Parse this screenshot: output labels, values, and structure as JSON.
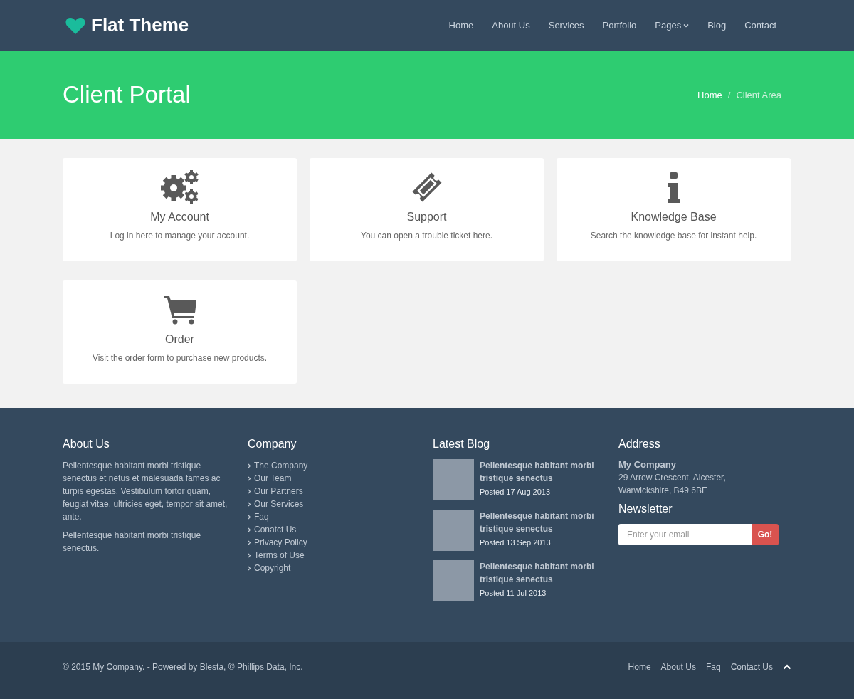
{
  "header": {
    "logo": "Flat Theme",
    "nav": [
      {
        "label": "Home",
        "dropdown": false
      },
      {
        "label": "About Us",
        "dropdown": false
      },
      {
        "label": "Services",
        "dropdown": false
      },
      {
        "label": "Portfolio",
        "dropdown": false
      },
      {
        "label": "Pages",
        "dropdown": true
      },
      {
        "label": "Blog",
        "dropdown": false
      },
      {
        "label": "Contact",
        "dropdown": false
      }
    ]
  },
  "banner": {
    "title": "Client Portal",
    "breadcrumb_separator": "/",
    "breadcrumb": [
      {
        "label": "Home",
        "current": false
      },
      {
        "label": "Client Area",
        "current": true
      }
    ]
  },
  "cards": [
    {
      "kind": "gears",
      "title": "My Account",
      "text": "Log in here to manage your account."
    },
    {
      "kind": "ticket",
      "title": "Support",
      "text": "You can open a trouble ticket here."
    },
    {
      "kind": "info",
      "title": "Knowledge Base",
      "text": "Search the knowledge base for instant help."
    },
    {
      "kind": "cart",
      "title": "Order",
      "text": "Visit the order form to purchase new products."
    }
  ],
  "footer": {
    "about": {
      "heading": "About Us",
      "paragraphs": [
        "Pellentesque habitant morbi tristique senectus et netus et malesuada fames ac turpis egestas. Vestibulum tortor quam, feugiat vitae, ultricies eget, tempor sit amet, ante.",
        "Pellentesque habitant morbi tristique senectus."
      ]
    },
    "company": {
      "heading": "Company",
      "links": [
        "The Company",
        "Our Team",
        "Our Partners",
        "Our Services",
        "Faq",
        "Conatct Us",
        "Privacy Policy",
        "Terms of Use",
        "Copyright"
      ]
    },
    "blog": {
      "heading": "Latest Blog",
      "posts": [
        {
          "title": "Pellentesque habitant morbi tristique senectus",
          "date": "Posted 17 Aug 2013"
        },
        {
          "title": "Pellentesque habitant morbi tristique senectus",
          "date": "Posted 13 Sep 2013"
        },
        {
          "title": "Pellentesque habitant morbi tristique senectus",
          "date": "Posted 11 Jul 2013"
        }
      ]
    },
    "address": {
      "heading": "Address",
      "company": "My Company",
      "lines": "29 Arrow Crescent, Alcester, Warwickshire, B49 6BE"
    },
    "newsletter": {
      "heading": "Newsletter",
      "placeholder": "Enter your email",
      "button": "Go!"
    }
  },
  "bottom_bar": {
    "copyright": "© 2015 My Company. - Powered by Blesta, © Phillips Data, Inc.",
    "links": [
      "Home",
      "About Us",
      "Faq",
      "Contact Us"
    ]
  }
}
